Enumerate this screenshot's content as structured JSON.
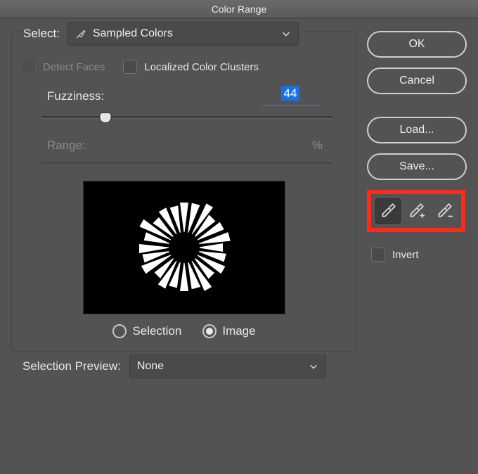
{
  "window": {
    "title": "Color Range"
  },
  "select": {
    "label": "Select:",
    "value": "Sampled Colors"
  },
  "detectFaces": {
    "label": "Detect Faces",
    "checked": false,
    "enabled": false
  },
  "localized": {
    "label": "Localized Color Clusters",
    "checked": false
  },
  "fuzziness": {
    "label": "Fuzziness:",
    "value": "44",
    "min": 0,
    "max": 200,
    "pos_pct": 22
  },
  "range": {
    "label": "Range:",
    "units": "%",
    "enabled": false
  },
  "viewMode": {
    "options": [
      {
        "id": "selection",
        "label": "Selection",
        "checked": false
      },
      {
        "id": "image",
        "label": "Image",
        "checked": true
      }
    ]
  },
  "buttons": {
    "ok": "OK",
    "cancel": "Cancel",
    "load": "Load...",
    "save": "Save..."
  },
  "eyedroppers": {
    "sample": {
      "name": "eyedropper-icon",
      "active": true
    },
    "add": {
      "name": "eyedropper-add-icon",
      "active": false
    },
    "subtract": {
      "name": "eyedropper-subtract-icon",
      "active": false
    }
  },
  "invert": {
    "label": "Invert",
    "checked": false
  },
  "selectionPreview": {
    "label": "Selection Preview:",
    "value": "None"
  }
}
